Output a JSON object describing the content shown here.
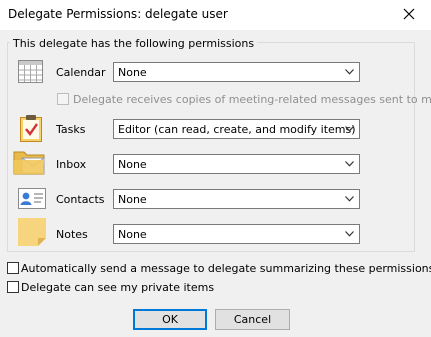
{
  "window": {
    "title": "Delegate Permissions: delegate user"
  },
  "group": {
    "legend": "This delegate has the following permissions"
  },
  "rows": {
    "calendar": {
      "label": "Calendar",
      "value": "None",
      "icon": "calendar-icon"
    },
    "tasks": {
      "label": "Tasks",
      "value": "Editor (can read, create, and modify items)",
      "icon": "tasks-clipboard-icon"
    },
    "inbox": {
      "label": "Inbox",
      "value": "None",
      "icon": "inbox-folder-icon"
    },
    "contacts": {
      "label": "Contacts",
      "value": "None",
      "icon": "contacts-card-icon"
    },
    "notes": {
      "label": "Notes",
      "value": "None",
      "icon": "note-icon"
    }
  },
  "options": {
    "meeting_copies": {
      "label": "Delegate receives copies of meeting-related messages sent to me",
      "checked": false,
      "enabled": false
    },
    "auto_send": {
      "label": "Automatically send a message to delegate summarizing these permissions",
      "checked": false
    },
    "private_items": {
      "label": "Delegate can see my private items",
      "checked": false
    }
  },
  "buttons": {
    "ok": "OK",
    "cancel": "Cancel"
  },
  "colors": {
    "accent": "#0078d7",
    "dialog_bg": "#f0f0f0",
    "title_bg": "#ffffff"
  }
}
